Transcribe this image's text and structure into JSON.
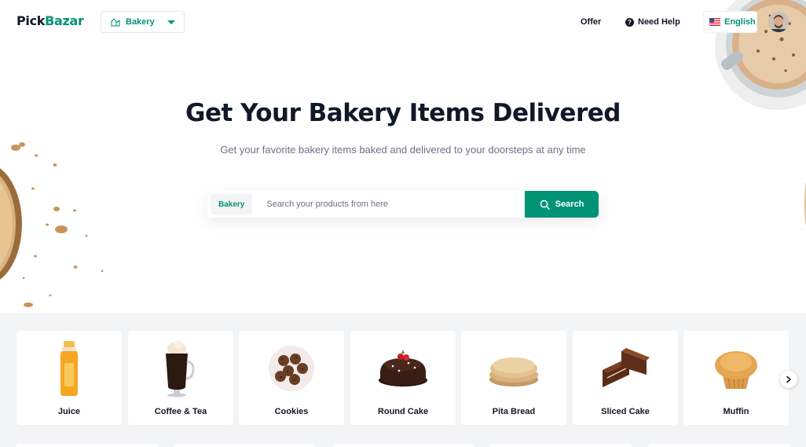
{
  "header": {
    "logo_part1": "Pick",
    "logo_part2": "Bazar",
    "category": "Bakery",
    "nav_offer": "Offer",
    "nav_help": "Need Help",
    "language": "English"
  },
  "hero": {
    "title": "Get Your Bakery Items Delivered",
    "subtitle": "Get your favorite bakery items baked and delivered to your doorsteps at any time",
    "search_category": "Bakery",
    "search_placeholder": "Search your products from here",
    "search_button": "Search"
  },
  "categories": [
    {
      "label": "Juice",
      "icon": "juice-icon"
    },
    {
      "label": "Coffee & Tea",
      "icon": "coffee-icon"
    },
    {
      "label": "Cookies",
      "icon": "cookies-icon"
    },
    {
      "label": "Round Cake",
      "icon": "round-cake-icon"
    },
    {
      "label": "Pita Bread",
      "icon": "pita-bread-icon"
    },
    {
      "label": "Sliced Cake",
      "icon": "sliced-cake-icon"
    },
    {
      "label": "Muffin",
      "icon": "muffin-icon"
    }
  ],
  "colors": {
    "accent": "#019376",
    "text_dark": "#111827",
    "text_muted": "#6b7280",
    "category_bg": "#f3f4f6"
  }
}
